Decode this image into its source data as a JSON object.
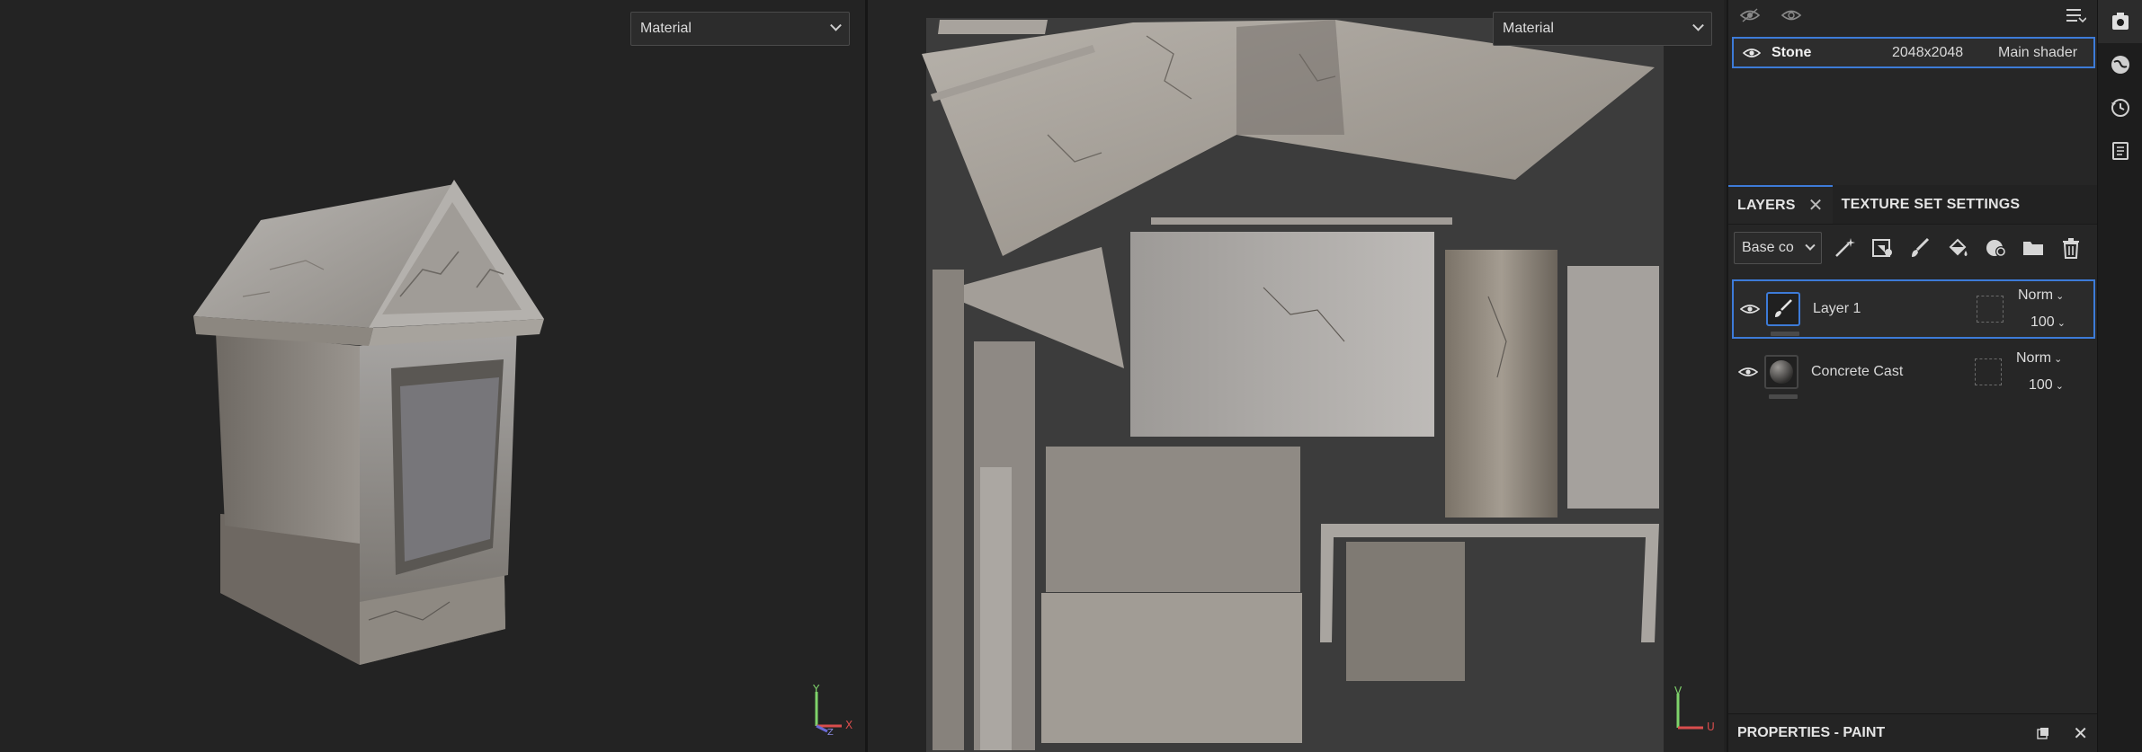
{
  "viewport3d": {
    "shading_select": "Material",
    "gizmo": {
      "y": "Y",
      "x": "X",
      "z": "Z"
    }
  },
  "viewport2d": {
    "shading_select": "Material",
    "gizmo": {
      "v": "V",
      "u": "U"
    }
  },
  "texture_set": {
    "name": "Stone",
    "resolution": "2048x2048",
    "shader": "Main shader"
  },
  "tabs": {
    "layers": "LAYERS",
    "texture_set_settings": "TEXTURE SET SETTINGS"
  },
  "channel_select": "Base co",
  "layers": [
    {
      "name": "Layer 1",
      "blend": "Norm",
      "opacity": "100"
    },
    {
      "name": "Concrete Cast",
      "blend": "Norm",
      "opacity": "100"
    }
  ],
  "properties": {
    "title": "PROPERTIES - PAINT"
  },
  "colors": {
    "accent": "#3d7bd8",
    "panel_bg": "#262626",
    "viewport_bg": "#232323"
  },
  "icons": [
    "eye-icon",
    "eye-alt-icon",
    "panel-menu-icon",
    "magic-wand-icon",
    "fill-icon",
    "brush-icon",
    "paint-bucket-icon",
    "smart-material-icon",
    "folder-icon",
    "trash-icon",
    "undock-icon",
    "close-icon",
    "shelf-icon",
    "environment-icon",
    "history-icon",
    "log-icon"
  ]
}
